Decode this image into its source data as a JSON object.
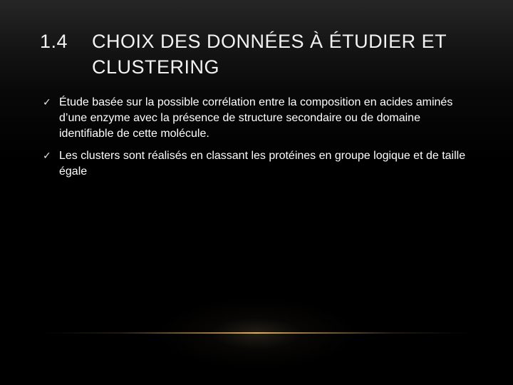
{
  "slide": {
    "title_number": "1.4",
    "title_line1": "CHOIX DES DONNÉES À ÉTUDIER ET",
    "title_line2": "CLUSTERING",
    "bullets": [
      {
        "icon": "checkmark-icon",
        "text": "Étude basée sur la possible corrélation entre la composition en acides aminés d’une enzyme avec la présence de structure secondaire ou de domaine identifiable de cette molécule."
      },
      {
        "icon": "checkmark-icon",
        "text": "Les clusters sont réalisés en classant les protéines en groupe logique et de taille égale"
      }
    ],
    "colors": {
      "background": "#000000",
      "text": "#ffffff",
      "accent_line": "#e6af5a"
    }
  }
}
